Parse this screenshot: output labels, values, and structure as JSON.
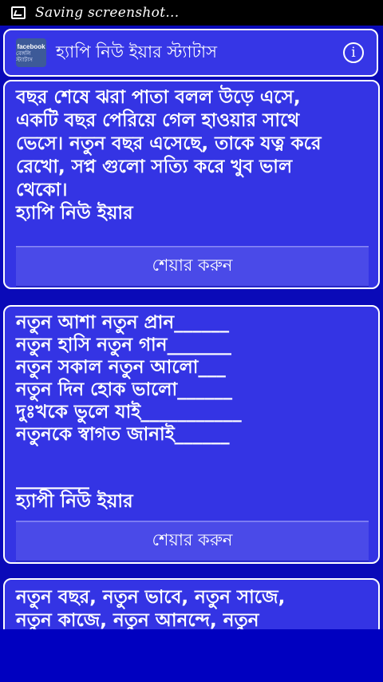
{
  "status_bar": {
    "text": "Saving screenshot..."
  },
  "app_bar": {
    "logo_top": "facebook",
    "logo_bottom": "বেঙ্গলি স্ট্যাটাস",
    "title": "হ্যাপি নিউ ইয়ার স্ট্যাটাস",
    "info_glyph": "i"
  },
  "cards": [
    {
      "text": "বছর শেষে ঝরা পাতা বলল উড়ে এসে,\nএকটি বছর পেরিয়ে গেল হাওয়ার সাথে\nভেসে। নতুন বছর এসেছে, তাকে যত্ন করে\nরেখো, সপ্ন গুলো সত্যি করে খুব ভাল\nথেকো।\nহ্যাপি নিউ ইয়ার",
      "share_label": "শেয়ার করুন"
    },
    {
      "text": "নতুন আশা নতুন প্রান______\nনতুন হাসি নতুন গান_______\nনতুন সকাল নতুন আলো___\nনতুন দিন হোক ভালো______\nদুঃখকে ভুলে যাই___________\nনতুনকে স্বাগত জানাই______\n\n________\nহ্যাপী নিউ ইয়ার",
      "share_label": "শেয়ার করুন"
    },
    {
      "text": " নতুন বছর, নতুন ভাবে, নতুন সাজে,\nনতুন কাজে, নতুন আনন্দে, নতুন",
      "share_label": ""
    }
  ]
}
